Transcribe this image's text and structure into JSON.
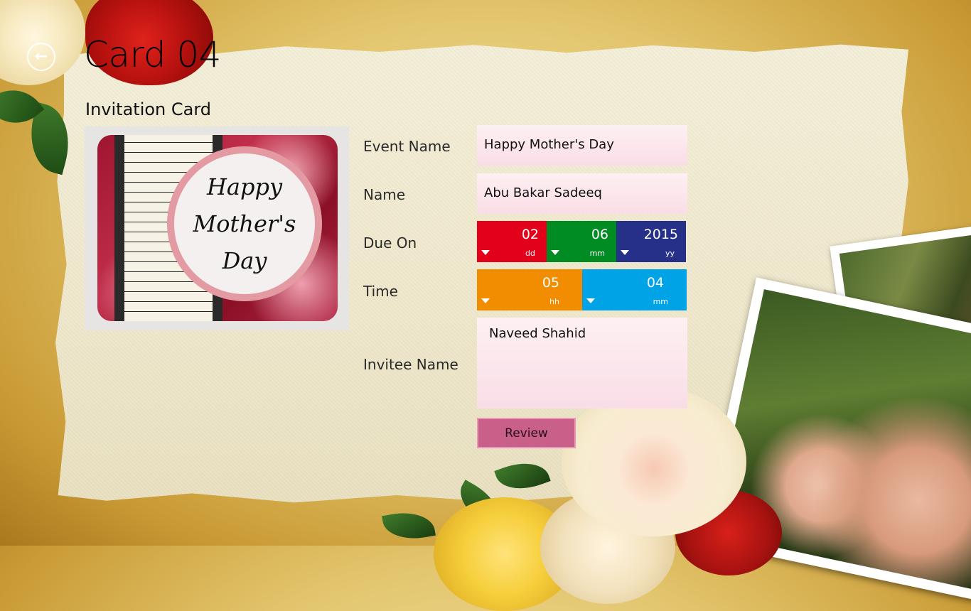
{
  "header": {
    "title": "Card 04",
    "subtitle": "Invitation Card",
    "back_icon": "back-arrow-icon"
  },
  "card_preview": {
    "lines": [
      "Happy",
      "Mother's",
      "Day"
    ]
  },
  "form": {
    "event_name": {
      "label": "Event Name",
      "value": "Happy Mother's Day"
    },
    "name": {
      "label": "Name",
      "value": "Abu Bakar Sadeeq"
    },
    "due_on": {
      "label": "Due On",
      "day": {
        "value": "02",
        "unit": "dd",
        "color": "#e3001b"
      },
      "month": {
        "value": "06",
        "unit": "mm",
        "color": "#008c23"
      },
      "year": {
        "value": "2015",
        "unit": "yy",
        "color": "#263089"
      }
    },
    "time": {
      "label": "Time",
      "hour": {
        "value": "05",
        "unit": "hh",
        "color": "#f28c00"
      },
      "minute": {
        "value": "04",
        "unit": "mm",
        "color": "#00a3e6"
      }
    },
    "invitee": {
      "label": "Invitee Name",
      "value": "Naveed Shahid"
    },
    "review_label": "Review"
  },
  "colors": {
    "review_button": "#c8608a",
    "field_background": "#fbe3ea"
  }
}
